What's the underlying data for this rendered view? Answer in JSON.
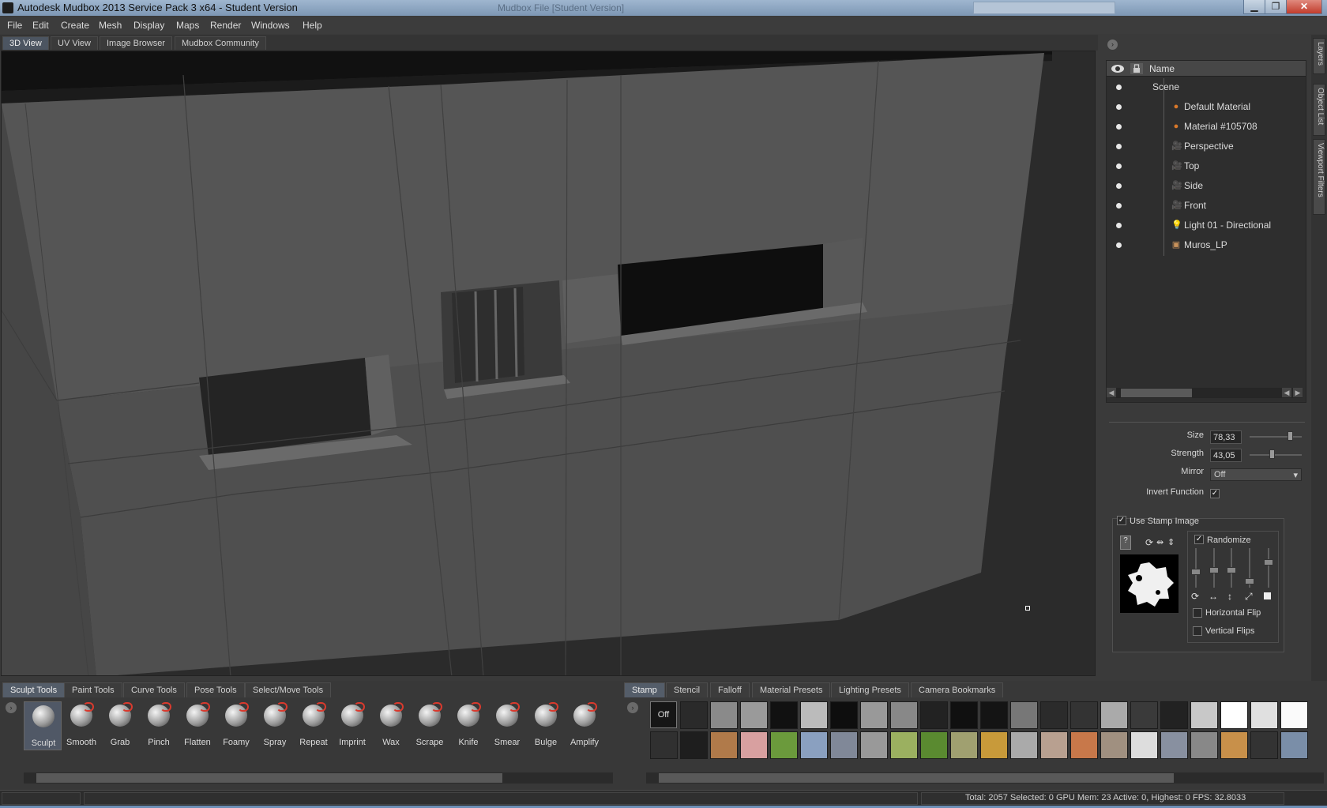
{
  "window": {
    "title": "Autodesk Mudbox 2013 Service Pack 3 x64 - Student Version",
    "faded_subtitle": "Mudbox File [Student Version]",
    "controls": [
      "minimize",
      "restore",
      "close"
    ]
  },
  "menu": [
    "File",
    "Edit",
    "Create",
    "Mesh",
    "Display",
    "Maps",
    "Render",
    "Windows",
    "Help"
  ],
  "view_tabs": [
    {
      "label": "3D View",
      "active": true
    },
    {
      "label": "UV View",
      "active": false
    },
    {
      "label": "Image Browser",
      "active": false
    },
    {
      "label": "Mudbox Community",
      "active": false
    }
  ],
  "object_list": {
    "header": "Name",
    "items": [
      {
        "label": "Scene",
        "icon": "tree-root-icon",
        "level": 0
      },
      {
        "label": "Default Material",
        "icon": "material-sphere-icon",
        "level": 2
      },
      {
        "label": "Material #105708",
        "icon": "material-sphere-icon",
        "level": 2
      },
      {
        "label": "Perspective",
        "icon": "camera-icon",
        "level": 1
      },
      {
        "label": "Top",
        "icon": "camera-icon",
        "level": 1
      },
      {
        "label": "Side",
        "icon": "camera-icon",
        "level": 1
      },
      {
        "label": "Front",
        "icon": "camera-icon",
        "level": 1
      },
      {
        "label": "Light 01 - Directional",
        "icon": "light-bulb-icon",
        "level": 2
      },
      {
        "label": "Muros_LP",
        "icon": "mesh-icon",
        "level": 1
      }
    ]
  },
  "properties": {
    "size_label": "Size",
    "size_value": "78,33",
    "size_slider": 0.78,
    "strength_label": "Strength",
    "strength_value": "43,05",
    "strength_slider": 0.43,
    "mirror_label": "Mirror",
    "mirror_value": "Off",
    "invert_label": "Invert Function",
    "invert_checked": true,
    "use_stamp_label": "Use Stamp Image",
    "use_stamp_checked": true,
    "randomize_label": "Randomize",
    "randomize_checked": true,
    "hflip_label": "Horizontal Flip",
    "vflip_label": "Vertical Flips"
  },
  "side_tabs": [
    "Layers",
    "Object List",
    "Viewport Filters"
  ],
  "tool_tabs": [
    {
      "label": "Sculpt Tools",
      "active": true
    },
    {
      "label": "Paint Tools",
      "active": false
    },
    {
      "label": "Curve Tools",
      "active": false
    },
    {
      "label": "Pose Tools",
      "active": false
    },
    {
      "label": "Select/Move Tools",
      "active": false
    }
  ],
  "tools": [
    "Sculpt",
    "Smooth",
    "Grab",
    "Pinch",
    "Flatten",
    "Foamy",
    "Spray",
    "Repeat",
    "Imprint",
    "Wax",
    "Scrape",
    "Knife",
    "Smear",
    "Bulge",
    "Amplify"
  ],
  "stamp_tabs": [
    {
      "label": "Stamp",
      "active": true
    },
    {
      "label": "Stencil",
      "active": false
    },
    {
      "label": "Falloff",
      "active": false
    },
    {
      "label": "Material Presets",
      "active": false
    },
    {
      "label": "Lighting Presets",
      "active": false
    },
    {
      "label": "Camera Bookmarks",
      "active": false
    }
  ],
  "stamp_off_label": "Off",
  "status": {
    "stats": "Total: 2057  Selected: 0 GPU Mem: 23  Active: 0, Highest: 0  FPS: 32.8033"
  },
  "colors": {
    "viewport_bg": "#2c2c2c",
    "wall": "#525252",
    "accent_tab": "#545d69"
  }
}
